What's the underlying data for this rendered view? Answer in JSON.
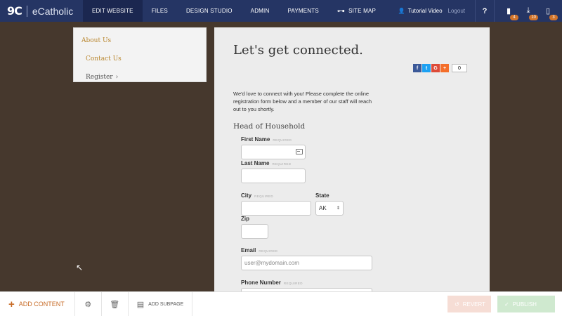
{
  "brand": {
    "mark": "9C",
    "name": "eCatholic"
  },
  "nav": [
    {
      "label": "EDIT WEBSITE"
    },
    {
      "label": "FILES"
    },
    {
      "label": "DESIGN STUDIO"
    },
    {
      "label": "ADMIN"
    },
    {
      "label": "PAYMENTS"
    },
    {
      "label": "SITE MAP"
    }
  ],
  "top_right": {
    "tutorial": "Tutorial Video",
    "logout": "Logout",
    "help": "?",
    "badges": [
      "4",
      "10",
      "3"
    ]
  },
  "subnav": [
    "About Us",
    "Contact Us",
    "Register"
  ],
  "page": {
    "title": "Let's get connected.",
    "share_count": "0",
    "intro": "We'd love to connect with you! Please complete the online registration form below and a member of our staff will reach out to you shortly.",
    "section": "Head of Household",
    "required": "REQUIRED",
    "fields": {
      "first_name": "First Name",
      "last_name": "Last Name",
      "city": "City",
      "state": "State",
      "state_value": "AK",
      "zip": "Zip",
      "email": "Email",
      "email_placeholder": "user@mydomain.com",
      "phone": "Phone Number"
    }
  },
  "bottom": {
    "add_content": "ADD CONTENT",
    "add_subpage": "ADD SUBPAGE",
    "revert": "REVERT",
    "publish": "PUBLISH"
  },
  "colors": {
    "topbar": "#253564",
    "accent": "#d1742b",
    "background": "#46382d"
  },
  "icons": [
    "settings-gear-icon",
    "trash-icon",
    "add-subpage-icon",
    "user-icon",
    "sitemap-icon"
  ]
}
